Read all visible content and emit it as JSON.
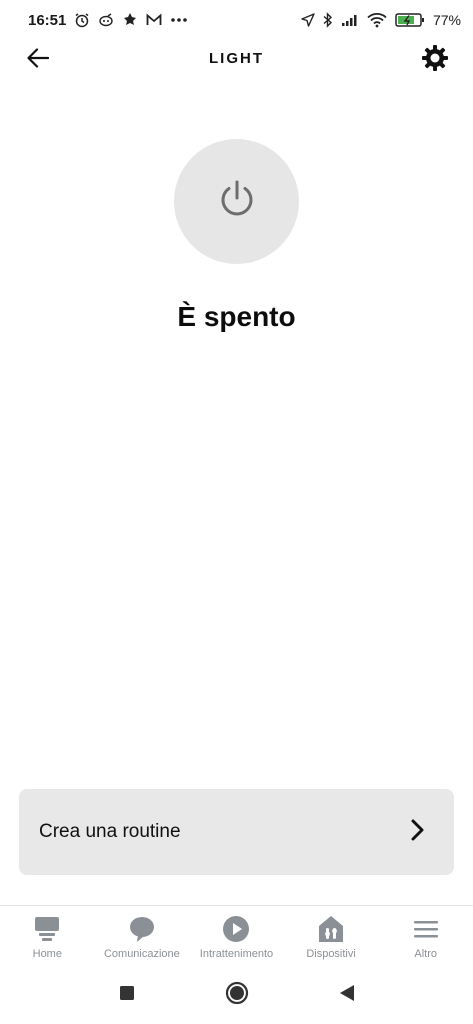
{
  "status_bar": {
    "time": "16:51",
    "battery_percent": "77%",
    "left_icons": [
      "alarm-icon",
      "logo-icon",
      "leaf-icon",
      "gmail-icon",
      "more-dots-icon"
    ],
    "right_icons": [
      "location-icon",
      "bluetooth-icon",
      "signal-icon",
      "wifi-icon",
      "battery-icon"
    ]
  },
  "app_bar": {
    "title": "LIGHT",
    "back_icon": "arrow-left-icon",
    "settings_icon": "gear-icon"
  },
  "device": {
    "power_icon": "power-icon",
    "state_text": "È spento"
  },
  "routine": {
    "label": "Crea una routine",
    "chevron_icon": "chevron-right-icon"
  },
  "bottom_nav": {
    "items": [
      {
        "label": "Home",
        "icon": "home-icon"
      },
      {
        "label": "Comunicazione",
        "icon": "chat-bubble-icon"
      },
      {
        "label": "Intrattenimento",
        "icon": "play-icon"
      },
      {
        "label": "Dispositivi",
        "icon": "devices-icon"
      },
      {
        "label": "Altro",
        "icon": "menu-icon"
      }
    ]
  },
  "colors": {
    "accent_gray": "#e6e6e6",
    "nav_label": "#8a9096",
    "text": "#111111"
  }
}
